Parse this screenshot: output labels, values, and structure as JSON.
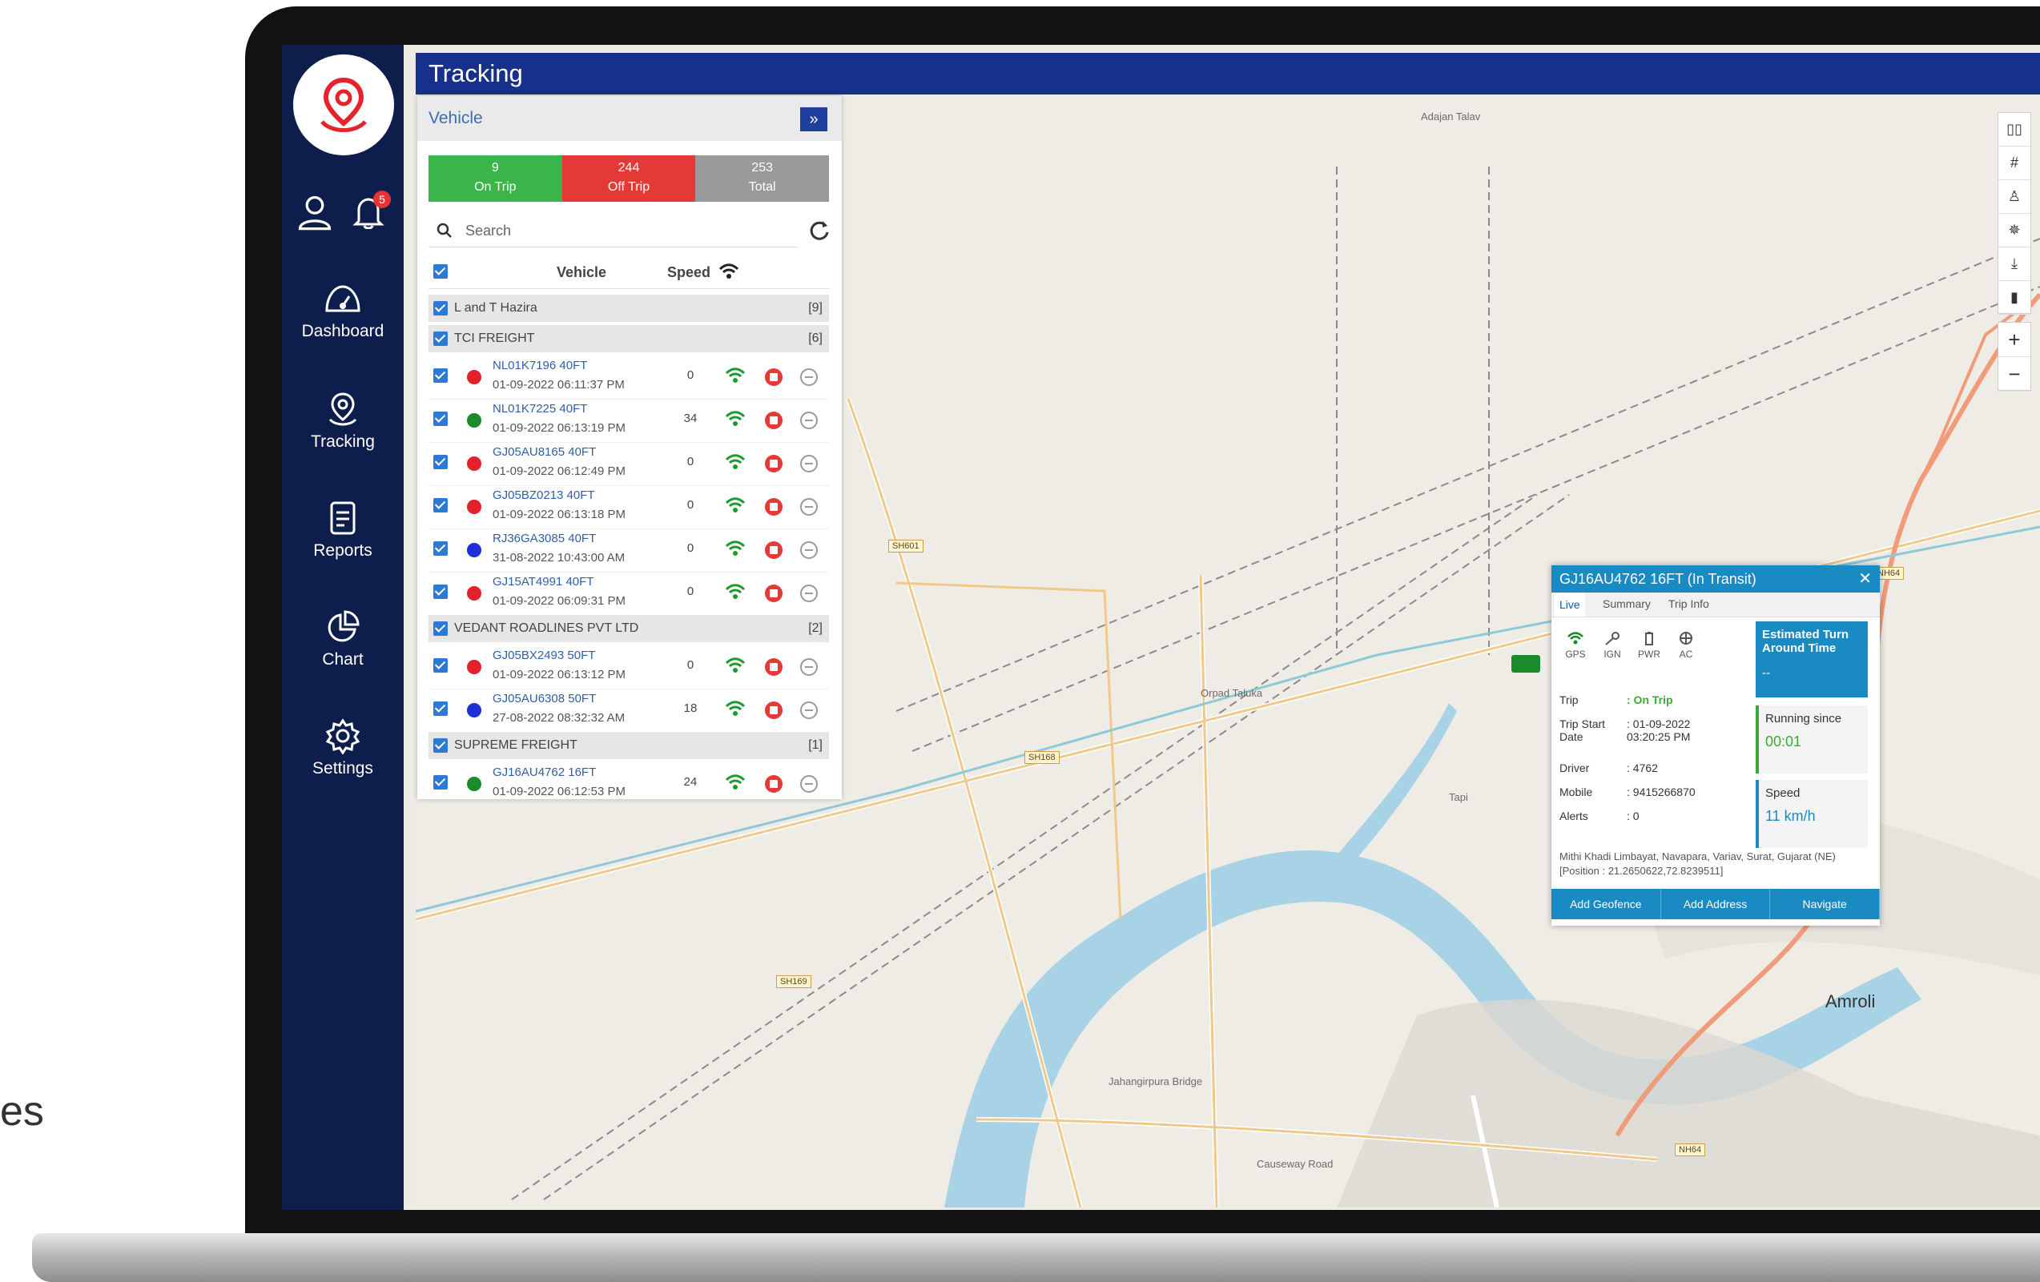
{
  "page": {
    "cut_text": "es"
  },
  "sidebar": {
    "notification_count": "5",
    "items": [
      {
        "label": "Dashboard",
        "icon": "dashboard-icon"
      },
      {
        "label": "Tracking",
        "icon": "tracking-icon"
      },
      {
        "label": "Reports",
        "icon": "reports-icon"
      },
      {
        "label": "Chart",
        "icon": "chart-icon"
      },
      {
        "label": "Settings",
        "icon": "settings-icon"
      }
    ]
  },
  "header": {
    "title": "Tracking"
  },
  "panel": {
    "title": "Vehicle",
    "expand_glyph": "»",
    "counts": [
      {
        "value": "9",
        "label": "On Trip",
        "color": "#3bb54a"
      },
      {
        "value": "244",
        "label": "Off Trip",
        "color": "#e53935"
      },
      {
        "value": "253",
        "label": "Total",
        "color": "#9a9a9a"
      }
    ],
    "search_placeholder": "Search",
    "columns": {
      "vehicle": "Vehicle",
      "speed": "Speed"
    },
    "groups": [
      {
        "name": "L and T Hazira",
        "count": "[9]",
        "vehicles": []
      },
      {
        "name": "TCI FREIGHT",
        "count": "[6]",
        "vehicles": [
          {
            "name": "NL01K7196 40FT",
            "time": "01-09-2022 06:11:37 PM",
            "speed": "0",
            "status_color": "#e3212b"
          },
          {
            "name": "NL01K7225 40FT",
            "time": "01-09-2022 06:13:19 PM",
            "speed": "34",
            "status_color": "#1a8a2a"
          },
          {
            "name": "GJ05AU8165 40FT",
            "time": "01-09-2022 06:12:49 PM",
            "speed": "0",
            "status_color": "#e3212b"
          },
          {
            "name": "GJ05BZ0213 40FT",
            "time": "01-09-2022 06:13:18 PM",
            "speed": "0",
            "status_color": "#e3212b"
          },
          {
            "name": "RJ36GA3085 40FT",
            "time": "31-08-2022 10:43:00 AM",
            "speed": "0",
            "status_color": "#1f2fd6"
          },
          {
            "name": "GJ15AT4991 40FT",
            "time": "01-09-2022 06:09:31 PM",
            "speed": "0",
            "status_color": "#e3212b"
          }
        ]
      },
      {
        "name": "VEDANT ROADLINES PVT LTD",
        "count": "[2]",
        "vehicles": [
          {
            "name": "GJ05BX2493 50FT",
            "time": "01-09-2022 06:13:12 PM",
            "speed": "0",
            "status_color": "#e3212b"
          },
          {
            "name": "GJ05AU6308 50FT",
            "time": "27-08-2022 08:32:32 AM",
            "speed": "18",
            "status_color": "#1f2fd6"
          }
        ]
      },
      {
        "name": "SUPREME FREIGHT",
        "count": "[1]",
        "vehicles": [
          {
            "name": "GJ16AU4762 16FT",
            "time": "01-09-2022 06:12:53 PM",
            "speed": "24",
            "status_color": "#1a8a2a"
          }
        ]
      }
    ]
  },
  "map_controls": {
    "zoom_in": "+",
    "zoom_out": "−"
  },
  "map_labels": {
    "sh601": "SH601",
    "sh168": "SH168",
    "sh169": "SH169",
    "nh64a": "NH64",
    "nh64b": "NH64",
    "amroli": "Amroli",
    "bridge": "Jahangirpura Bridge",
    "road": "Causeway Road",
    "place1": "Adajan Talav",
    "place2": "Orpad Taluka",
    "place3": "Tapi"
  },
  "popup": {
    "title": "GJ16AU4762 16FT (In Transit)",
    "tabs": [
      "Live",
      "Summary",
      "Trip Info"
    ],
    "status_icons": [
      "GPS",
      "IGN",
      "PWR",
      "AC"
    ],
    "eta_label": "Estimated Turn Around Time",
    "eta_value": "--",
    "fields": [
      {
        "key": "Trip",
        "value": ": On Trip"
      },
      {
        "key": "Trip Start Date",
        "value": ": 01-09-2022 03:20:25 PM"
      },
      {
        "key": "Driver",
        "value": ": 4762"
      },
      {
        "key": "Mobile",
        "value": ": 9415266870"
      },
      {
        "key": "Alerts",
        "value": ": 0"
      }
    ],
    "running_label": "Running since",
    "running_value": "00:01",
    "speed_label": "Speed",
    "speed_value": "11 km/h",
    "address": "Mithi Khadi Limbayat, Navapara, Variav, Surat, Gujarat (NE) [Position : 21.2650622,72.8239511]",
    "actions": [
      "Add Geofence",
      "Add Address",
      "Navigate"
    ]
  }
}
